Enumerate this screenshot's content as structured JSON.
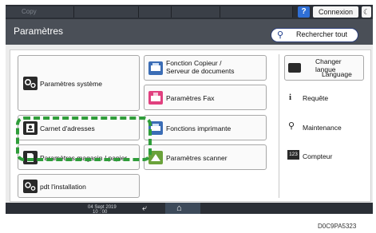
{
  "topbar": {
    "mode_label": "Copy",
    "help_label": "?",
    "login_label": "Connexion",
    "moon_glyph": "☾"
  },
  "title": "Paramètres",
  "search": {
    "label": "Rechercher tout"
  },
  "tiles": {
    "system": "Paramètres système",
    "copier": [
      "Fonction Copieur /",
      "Serveur de documents"
    ],
    "fax": "Paramètres Fax",
    "address": "Carnet d'adresses",
    "printer": "Fonctions imprimante",
    "tray": "Paramètres magasin / papier",
    "scanner": "Paramètres scanner",
    "install": "pdt l'installation",
    "lang_top": "Changer langue",
    "lang_bottom": "Language",
    "query": "Requête",
    "maint": "Maintenance",
    "counter": "Compteur",
    "counter_badge": "123"
  },
  "bottombar": {
    "date": "04 Sept 2019",
    "time": "10 : 00"
  },
  "figure_code": "D0C9PA5323",
  "colors": {
    "highlight": "#2f9d3a",
    "accent": "#2f6fd6",
    "bar": "#2b2f36"
  }
}
